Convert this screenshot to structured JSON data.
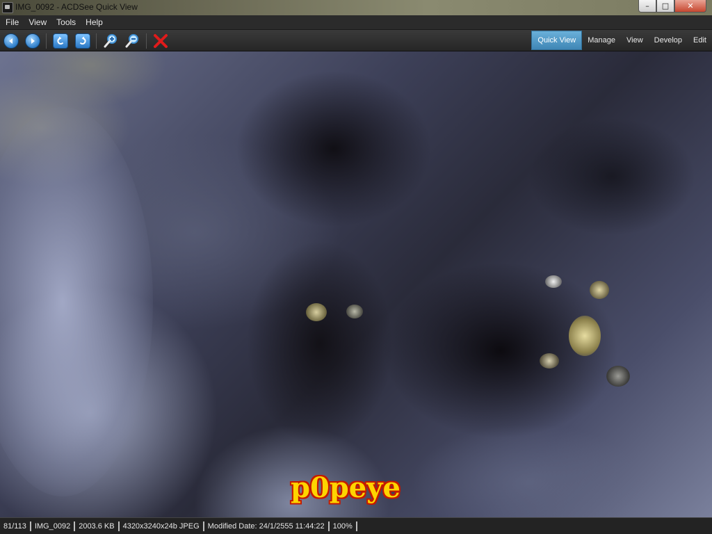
{
  "window": {
    "title": "IMG_0092 - ACDSee Quick View",
    "controls": {
      "minimize": "–",
      "maximize": "□",
      "close": "✕"
    }
  },
  "menu": [
    "File",
    "View",
    "Tools",
    "Help"
  ],
  "toolbar": {
    "buttons": [
      {
        "name": "previous",
        "icon": "arrow-left-icon"
      },
      {
        "name": "next",
        "icon": "arrow-right-icon"
      },
      {
        "name": "rotate-left",
        "icon": "rotate-left-icon"
      },
      {
        "name": "rotate-right",
        "icon": "rotate-right-icon"
      },
      {
        "name": "zoom-in",
        "icon": "zoom-in-icon"
      },
      {
        "name": "zoom-out",
        "icon": "zoom-out-icon"
      },
      {
        "name": "delete",
        "icon": "delete-x-icon"
      }
    ],
    "modes": [
      "Quick View",
      "Manage",
      "View",
      "Develop",
      "Edit"
    ],
    "active_mode": "Quick View"
  },
  "image": {
    "watermark": "p0peye"
  },
  "status": {
    "position": "81/113",
    "filename": "IMG_0092",
    "filesize": "2003.6 KB",
    "dimensions": "4320x3240x24b JPEG",
    "modified": "Modified Date: 24/1/2555 11:44:22",
    "zoom": "100%"
  },
  "colors": {
    "accent_active_tab": "#4f97c6",
    "delete_red": "#e01b1b",
    "watermark_fill": "#ffd400",
    "watermark_outline": "#c41a00"
  }
}
